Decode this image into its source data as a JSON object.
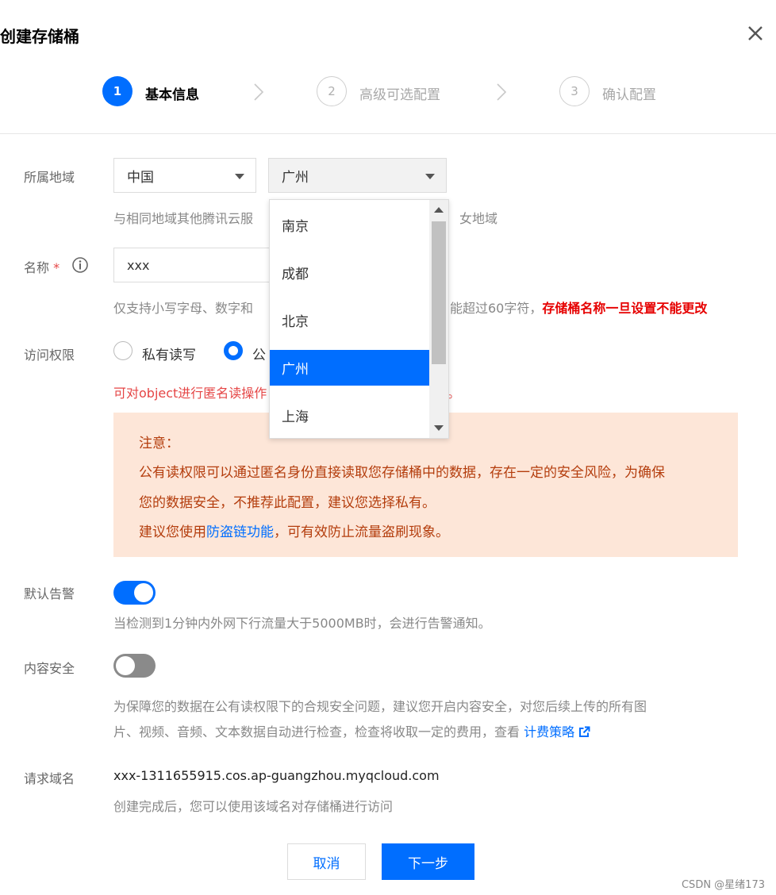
{
  "dialog": {
    "title": "创建存储桶"
  },
  "steps": [
    {
      "number": "1",
      "label": "基本信息"
    },
    {
      "number": "2",
      "label": "高级可选配置"
    },
    {
      "number": "3",
      "label": "确认配置"
    }
  ],
  "region": {
    "label": "所属地域",
    "country_value": "中国",
    "city_value": "广州",
    "help_left": "与相同地域其他腾讯云服",
    "help_right": "女地域",
    "options": [
      "南京",
      "成都",
      "北京",
      "广州",
      "上海"
    ],
    "selected_option": "广州"
  },
  "name": {
    "label": "名称",
    "required_mark": "*",
    "value": "xxx",
    "help_left": "仅支持小写字母、数字和",
    "help_right": "能超过60字符，",
    "help_warning": "存储桶名称一旦设置不能更改"
  },
  "access": {
    "label": "访问权限",
    "options": [
      "私有读写",
      "公"
    ],
    "hint_text": "可对object进行匿名读操作",
    "hint_tail": "。"
  },
  "notice": {
    "title": "注意：",
    "line1": "公有读权限可以通过匿名身份直接读取您存储桶中的数据，存在一定的安全风险，为确保",
    "line2": "您的数据安全，不推荐此配置，建议您选择私有。",
    "line3_prefix": "建议您使用",
    "line3_link": "防盗链功能",
    "line3_suffix": "，可有效防止流量盗刷现象。"
  },
  "alarm": {
    "label": "默认告警",
    "enabled": true,
    "help": "当检测到1分钟内外网下行流量大于5000MB时，会进行告警通知。"
  },
  "content_security": {
    "label": "内容安全",
    "enabled": false,
    "help_line1": "为保障您的数据在公有读权限下的合规安全问题，建议您开启内容安全，对您后续上传的所有图",
    "help_line2": "片、视频、音频、文本数据自动进行检查，检查将收取一定的费用，查看",
    "help_link": "计费策略"
  },
  "domain": {
    "label": "请求域名",
    "value": "xxx-1311655915.cos.ap-guangzhou.myqcloud.com",
    "help": "创建完成后，您可以使用该域名对存储桶进行访问"
  },
  "buttons": {
    "cancel": "取消",
    "next": "下一步"
  },
  "watermark": "CSDN @星绪173",
  "colors": {
    "primary": "#006eff",
    "warning_text": "#b43d0d",
    "warning_bg": "#fde6d8",
    "required": "#e54545",
    "danger": "#e60000"
  }
}
